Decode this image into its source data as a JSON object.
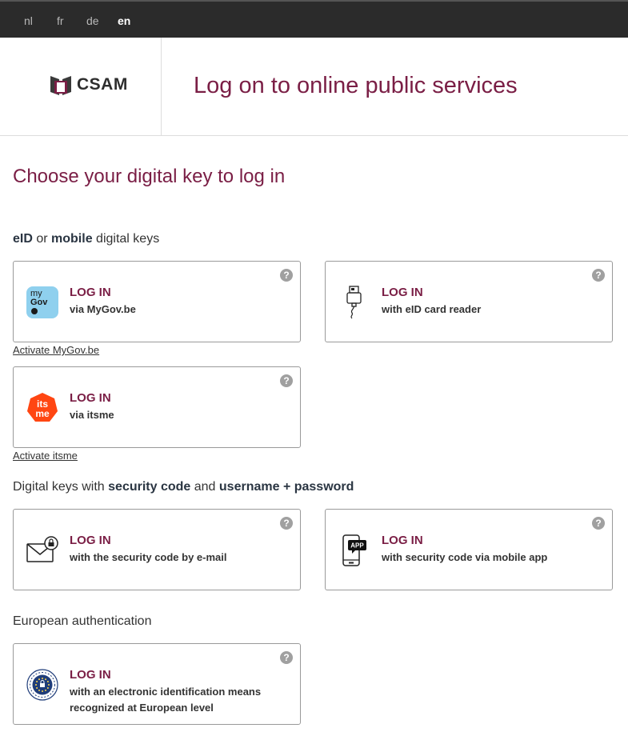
{
  "languages": [
    "nl",
    "fr",
    "de",
    "en"
  ],
  "active_language": "en",
  "logo": {
    "text": "CSAM"
  },
  "header": {
    "title": "Log on to online public services"
  },
  "main": {
    "title": "Choose your digital key to log in"
  },
  "sections": {
    "eid": {
      "part1": "eID",
      "part2": " or ",
      "part3": "mobile",
      "part4": " digital keys"
    },
    "security": {
      "part1": "Digital keys with ",
      "part2": "security code",
      "part3": " and ",
      "part4": "username + password"
    },
    "european": {
      "title": "European authentication"
    }
  },
  "cards": {
    "mygov": {
      "login": "LOG IN",
      "sub": "via MyGov.be",
      "icon": "mygov-icon",
      "icon_text1": "my",
      "icon_text2": "Gov"
    },
    "eid_reader": {
      "login": "LOG IN",
      "sub": "with eID card reader",
      "icon": "card-reader-icon"
    },
    "itsme": {
      "login": "LOG IN",
      "sub": "via itsme",
      "icon": "itsme-icon"
    },
    "email_code": {
      "login": "LOG IN",
      "sub": "with the security code by e-mail",
      "icon": "mail-lock-icon"
    },
    "app_code": {
      "login": "LOG IN",
      "sub": "with security code via mobile app",
      "icon": "mobile-app-icon",
      "icon_badge": "APP"
    },
    "european": {
      "login": "LOG IN",
      "sub_line1": "with an electronic identification means",
      "sub_line2": "recognized at European level",
      "icon": "eu-stars-icon"
    }
  },
  "help_symbol": "?",
  "links": {
    "activate_mygov": "Activate MyGov.be",
    "activate_itsme": "Activate itsme"
  },
  "colors": {
    "accent": "#7a1e45",
    "topbar": "#2b2b2b",
    "itsme": "#ff4612",
    "mygov": "#8fd0ee",
    "eu": "#1f3d7a"
  }
}
